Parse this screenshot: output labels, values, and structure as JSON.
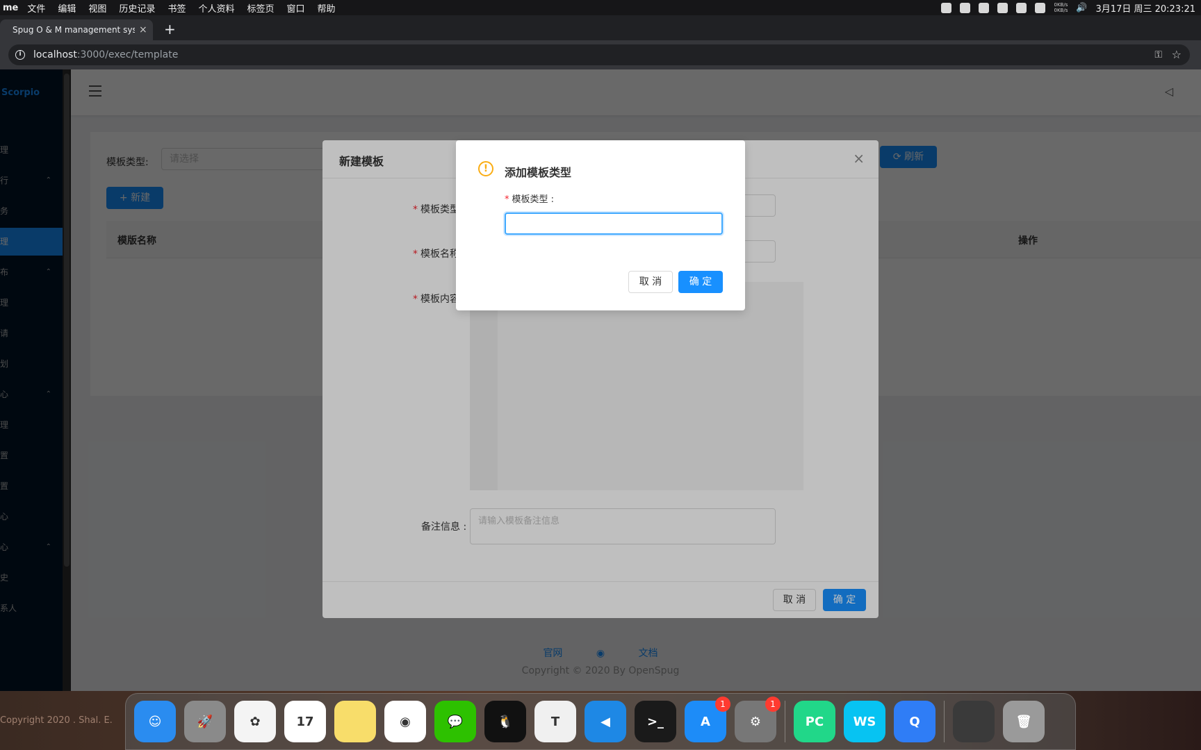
{
  "menubar": {
    "app": "me",
    "items": [
      "文件",
      "编辑",
      "视图",
      "历史记录",
      "书签",
      "个人资料",
      "标签页",
      "窗口",
      "帮助"
    ],
    "net_up": "0KB/s",
    "net_down": "0KB/s",
    "clock": "3月17日 周三  20:23:21"
  },
  "browser": {
    "tab_title": "Spug O & M management system",
    "tab_close": "×",
    "new_tab": "+",
    "url_host": "localhost",
    "url_path": ":3000/exec/template"
  },
  "sidebar": {
    "brand": "Scorpio",
    "items": [
      {
        "label": "理",
        "arrow": ""
      },
      {
        "label": "行",
        "arrow": "⌃"
      },
      {
        "label": "务",
        "arrow": ""
      },
      {
        "label": "理",
        "arrow": ""
      },
      {
        "label": "布",
        "arrow": "⌃"
      },
      {
        "label": "理",
        "arrow": ""
      },
      {
        "label": "请",
        "arrow": ""
      },
      {
        "label": "划",
        "arrow": ""
      },
      {
        "label": "心",
        "arrow": "⌃"
      },
      {
        "label": "理",
        "arrow": ""
      },
      {
        "label": "置",
        "arrow": ""
      },
      {
        "label": "置",
        "arrow": ""
      },
      {
        "label": "心",
        "arrow": ""
      },
      {
        "label": "心",
        "arrow": "⌃"
      },
      {
        "label": "史",
        "arrow": ""
      },
      {
        "label": "系人",
        "arrow": ""
      }
    ]
  },
  "page": {
    "filter_label": "模板类型:",
    "filter_placeholder": "请选择",
    "refresh_label": "刷新",
    "new_label": "+ 新建",
    "columns": [
      "模版名称",
      "操作"
    ],
    "footer_links": [
      "官网",
      "文档"
    ],
    "copyright": "Copyright © 2020 By OpenSpug"
  },
  "modal": {
    "title": "新建模板",
    "close": "×",
    "fields": {
      "type_label": "模板类型",
      "name_label": "模板名称",
      "content_label": "模板内容",
      "remark_label": "备注信息 :",
      "remark_placeholder": "请输入模板备注信息"
    },
    "cancel_label": "取 消",
    "ok_label": "确 定"
  },
  "confirm": {
    "icon": "!",
    "title": "添加模板类型",
    "field_label": "模板类型 :",
    "input_value": "",
    "cancel_label": "取 消",
    "ok_label": "确 定"
  },
  "desktop": {
    "watermark": "Copyright 2020 . Shal. E."
  },
  "dock": {
    "apps": [
      {
        "name": "finder",
        "label": "☺",
        "color": "#2a8cf0"
      },
      {
        "name": "launchpad",
        "label": "🚀",
        "color": "#8a8a8a"
      },
      {
        "name": "photos",
        "label": "✿",
        "color": "#f4f4f4"
      },
      {
        "name": "calendar",
        "label": "17",
        "color": "#ffffff"
      },
      {
        "name": "notes",
        "label": "",
        "color": "#f8dd6a"
      },
      {
        "name": "chrome",
        "label": "◉",
        "color": "#ffffff"
      },
      {
        "name": "wechat",
        "label": "💬",
        "color": "#2dc100"
      },
      {
        "name": "qq",
        "label": "🐧",
        "color": "#111111"
      },
      {
        "name": "typora",
        "label": "T",
        "color": "#f0f0f0"
      },
      {
        "name": "vscode",
        "label": "◀",
        "color": "#1e88e5"
      },
      {
        "name": "terminal",
        "label": ">_",
        "color": "#1a1a1a"
      },
      {
        "name": "app-store",
        "label": "A",
        "color": "#1d8cf8",
        "badge": "1"
      },
      {
        "name": "system-preferences",
        "label": "⚙",
        "color": "#777777",
        "badge": "1"
      },
      {
        "name": "pycharm",
        "label": "PC",
        "color": "#21d789"
      },
      {
        "name": "webstorm",
        "label": "WS",
        "color": "#07c3f2"
      },
      {
        "name": "quicktime",
        "label": "Q",
        "color": "#2f7df6"
      },
      {
        "name": "screenshot-preview",
        "label": "",
        "color": "#3a3a3a"
      },
      {
        "name": "trash",
        "label": "🗑",
        "color": "#9a9a9a"
      }
    ]
  }
}
